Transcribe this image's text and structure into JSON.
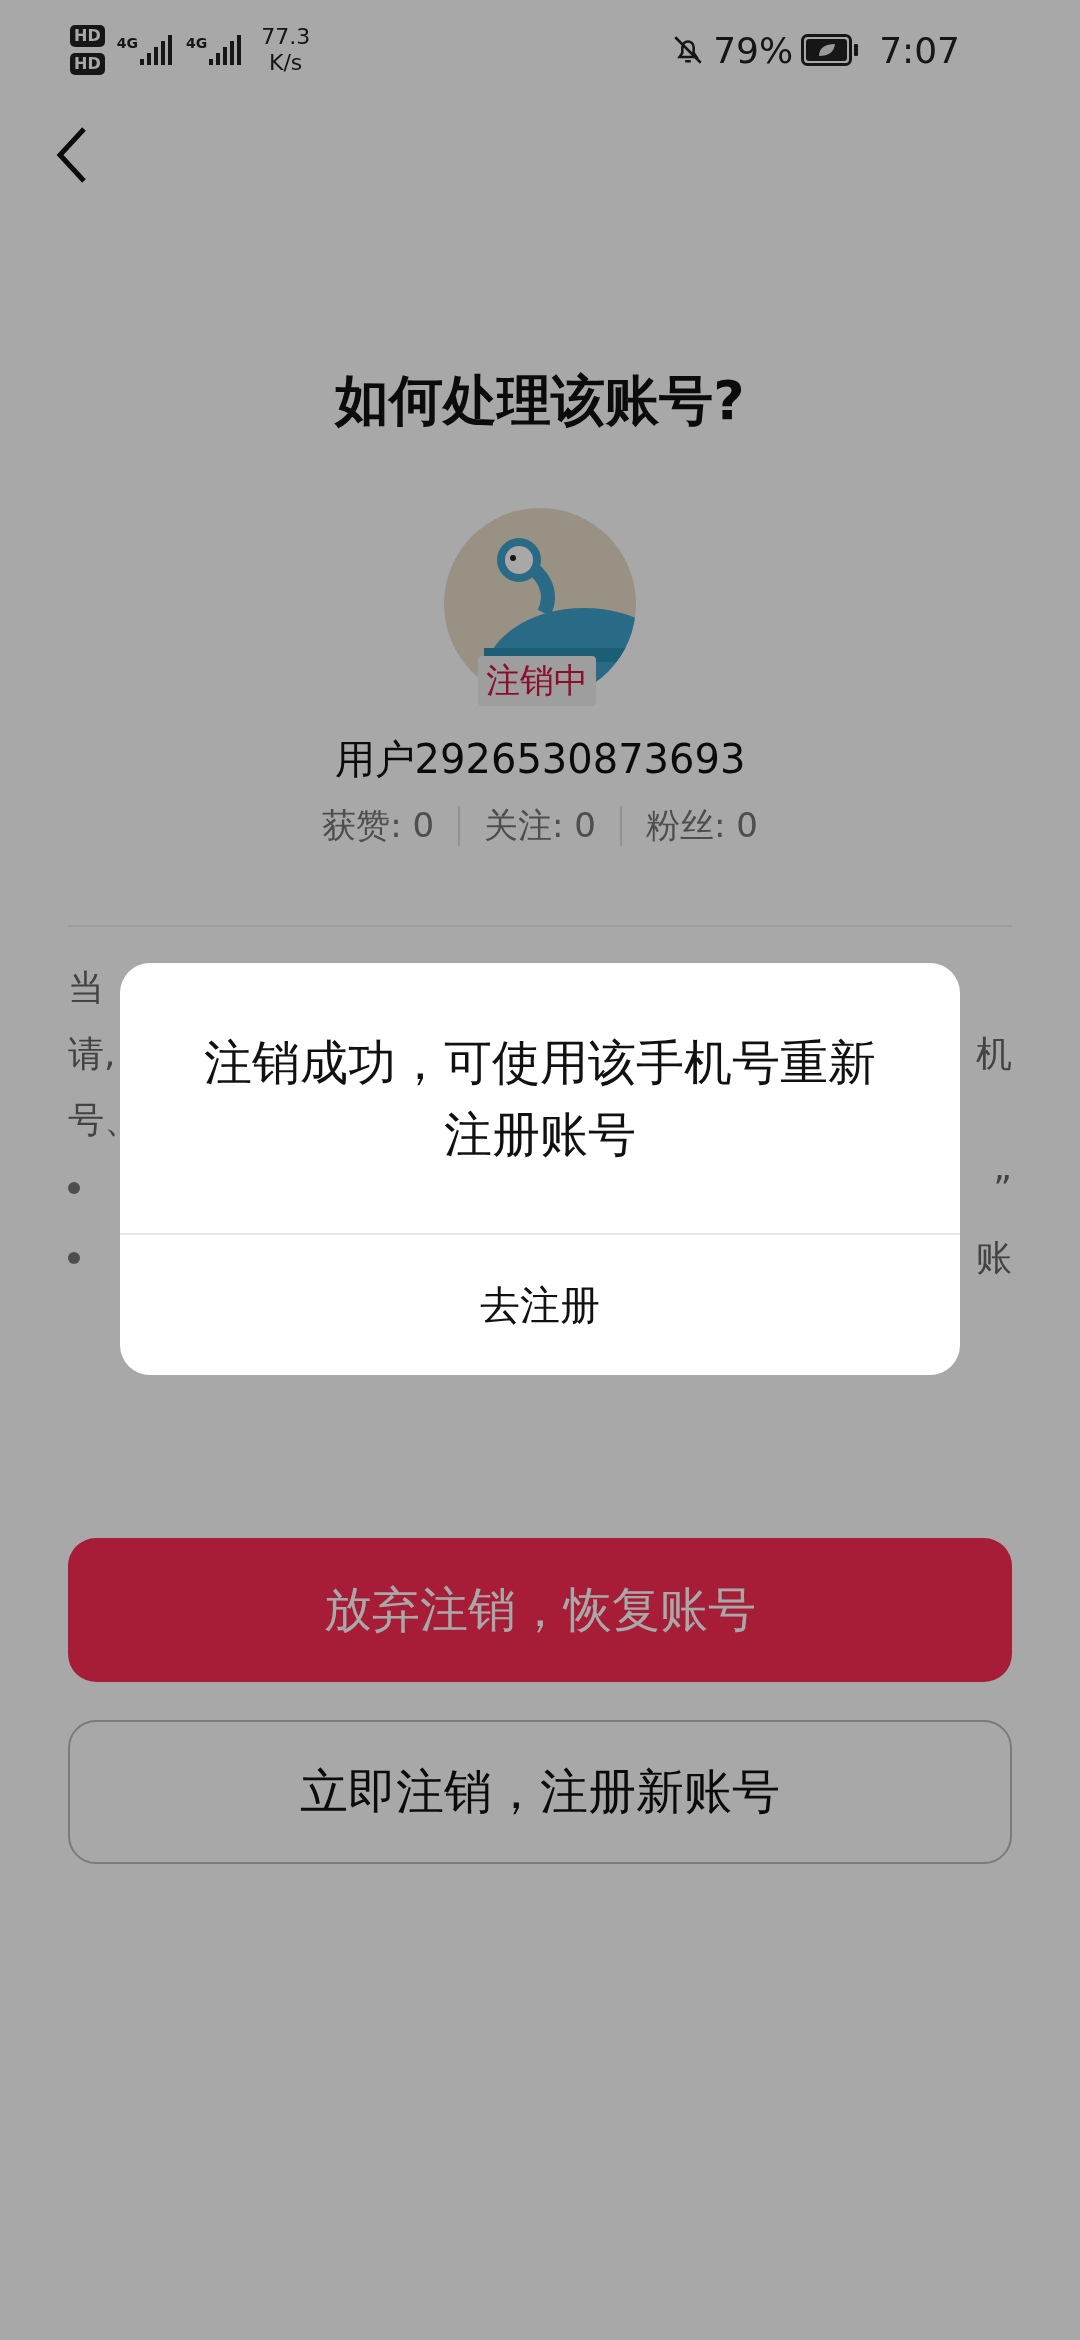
{
  "status_bar": {
    "hd_badges": [
      "HD",
      "HD"
    ],
    "networks": [
      "4G",
      "4G"
    ],
    "speed": "77.3",
    "speed_unit": "K/s",
    "battery": "79%",
    "time": "7:07"
  },
  "title": "如何处理该账号?",
  "profile": {
    "badge": "注销中",
    "username": "用户2926530873693",
    "stats": [
      {
        "label": "获赞: 0"
      },
      {
        "label": "关注: 0"
      },
      {
        "label": "粉丝: 0"
      }
    ]
  },
  "notice_fragments": [
    {
      "kind": "line",
      "left": "当"
    },
    {
      "kind": "line",
      "left": "请,",
      "right": "机"
    },
    {
      "kind": "line",
      "left": "号、"
    },
    {
      "kind": "bullet",
      "right": "”"
    },
    {
      "kind": "bullet",
      "right": "账"
    }
  ],
  "buttons": [
    {
      "kind": "primary",
      "label": "放弃注销，恢复账号"
    },
    {
      "kind": "outline",
      "label": "立即注销，注册新账号"
    }
  ],
  "dialog": {
    "message": "注销成功，可使用该手机号重新注册账号",
    "action": "去注册"
  }
}
